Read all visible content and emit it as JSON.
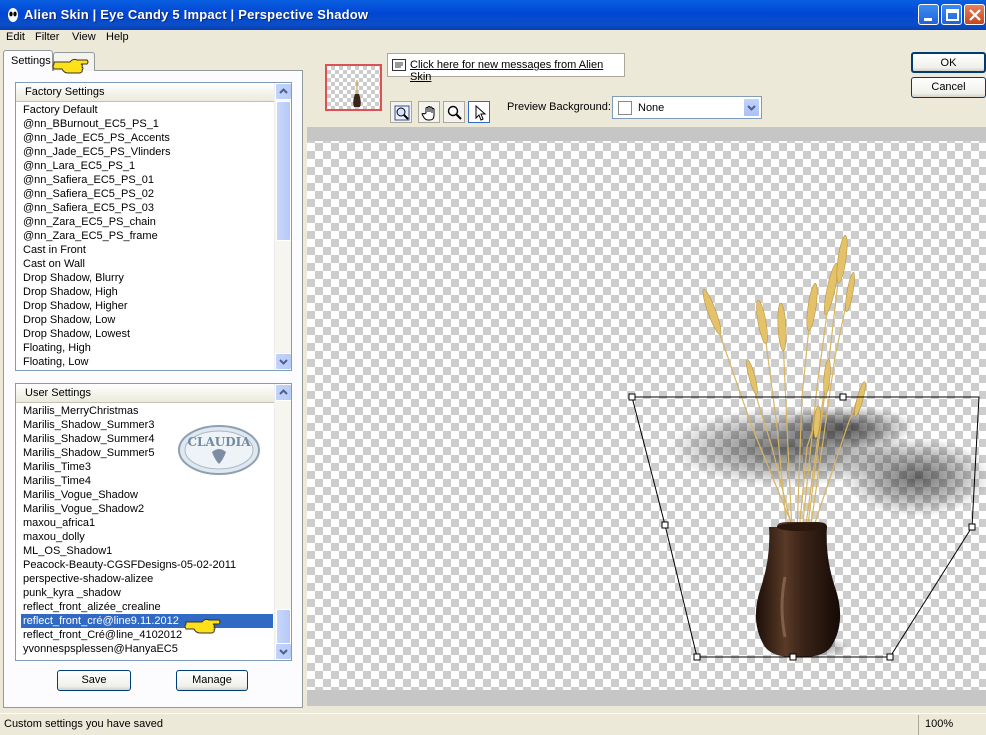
{
  "window": {
    "title": "Alien Skin  |  Eye Candy 5 Impact  |  Perspective Shadow"
  },
  "menu": [
    "Edit",
    "Filter",
    "View",
    "Help"
  ],
  "tabs": {
    "settings_label": "Settings"
  },
  "factory_settings": {
    "header": "Factory Settings",
    "items": [
      "Factory Default",
      "@nn_BBurnout_EC5_PS_1",
      "@nn_Jade_EC5_PS_Accents",
      "@nn_Jade_EC5_PS_Vlinders",
      "@nn_Lara_EC5_PS_1",
      "@nn_Safiera_EC5_PS_01",
      "@nn_Safiera_EC5_PS_02",
      "@nn_Safiera_EC5_PS_03",
      "@nn_Zara_EC5_PS_chain",
      "@nn_Zara_EC5_PS_frame",
      "Cast in Front",
      "Cast on Wall",
      "Drop Shadow, Blurry",
      "Drop Shadow, High",
      "Drop Shadow, Higher",
      "Drop Shadow, Low",
      "Drop Shadow, Lowest",
      "Floating, High",
      "Floating, Low"
    ]
  },
  "user_settings": {
    "header": "User Settings",
    "items": [
      "Marilis_MerryChristmas",
      "Marilis_Shadow_Summer3",
      "Marilis_Shadow_Summer4",
      "Marilis_Shadow_Summer5",
      "Marilis_Time3",
      "Marilis_Time4",
      "Marilis_Vogue_Shadow",
      "Marilis_Vogue_Shadow2",
      "maxou_africa1",
      "maxou_dolly",
      "ML_OS_Shadow1",
      "Peacock-Beauty-CGSFDesigns-05-02-2011",
      "perspective-shadow-alizee",
      "punk_kyra _shadow",
      "reflect_front_alizée_crealine",
      "reflect_front_cré@line9.11.2012",
      "reflect_front_Cré@line_4102012",
      "yvonnespsplessen@HanyaEC5"
    ],
    "selected_index": 15,
    "watermark": "CLAUDIA"
  },
  "buttons": {
    "save": "Save",
    "manage": "Manage",
    "ok": "OK",
    "cancel": "Cancel"
  },
  "messages_link": "Click here for new messages from Alien Skin",
  "preview_background": {
    "label": "Preview Background:",
    "value": "None"
  },
  "status": {
    "text": "Custom settings you have saved",
    "zoom": "100%"
  },
  "colors": {
    "titlebar": "#0046d5",
    "selection": "#316ac5",
    "vase": "#3b2418"
  }
}
